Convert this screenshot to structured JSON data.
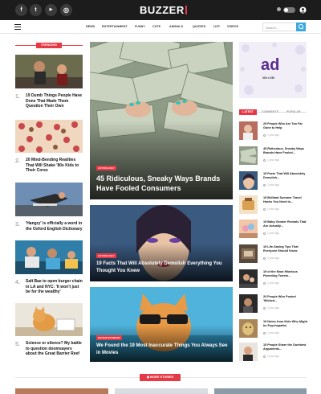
{
  "brand": {
    "logo": "BUZZER"
  },
  "header": {
    "social_icons": [
      "facebook-icon",
      "twitter-icon",
      "youtube-icon",
      "instagram-icon"
    ],
    "social_glyphs": [
      "f",
      "t",
      "▶",
      "◎"
    ]
  },
  "nav": {
    "items": [
      "NEWS",
      "ENTERTAINMENT",
      "FUNNY",
      "CUTE",
      "ANIMALS",
      "QUIZZES",
      "LIST",
      "VIDEOS"
    ],
    "search_placeholder": "Search..."
  },
  "trending": {
    "label": "TRENDING",
    "items": [
      {
        "num": "1.",
        "title": "19 Dumb Things People Have Done That Made Them Question Their Own"
      },
      {
        "num": "2.",
        "title": "20 Mind-Bending Realities That Will Shake '80s Kids to Their Cores"
      },
      {
        "num": "3.",
        "title": "'Hangry' is officially a word in the Oxford English Dictionary"
      },
      {
        "num": "4.",
        "title": "Salt Bae to open burger chain in LA and NYC: 'It won't just be for the wealthy'"
      },
      {
        "num": "5.",
        "title": "Science or silence? My battle to question doomsayers about the Great Barrier Reef"
      }
    ]
  },
  "featured": [
    {
      "category": "ASTROLOGY",
      "title": "45 Ridiculous, Sneaky Ways Brands Have Fooled Consumers"
    },
    {
      "category": "ASTROLOGY",
      "title": "19 Facts That Will Absolutely Demolish Everything You Thought You Knew"
    },
    {
      "category": "ENTERTAINMENT",
      "title": "We Found the 19 Most Inaccurate Things You Always See in Movies"
    }
  ],
  "ad": {
    "text": "ad",
    "size": "300 x 250"
  },
  "sidebar": {
    "tabs": [
      "LATEST",
      "COMMENTS",
      "POPULAR"
    ],
    "items": [
      {
        "title": "25 People Who Are Too Far Gone to Help",
        "meta": "1 year ago"
      },
      {
        "title": "45 Ridiculous, Sneaky Ways Brands Have Fooled...",
        "meta": "1 year ago"
      },
      {
        "title": "19 Facts That Will Absolutely Demolish...",
        "meta": "1 year ago"
      },
      {
        "title": "19 Brilliant Summer Travel Hacks You Need to...",
        "meta": "1 year ago"
      },
      {
        "title": "19 Baby Gender Reveals That Are Actually...",
        "meta": "1 year ago"
      },
      {
        "title": "19 Life-Saving Tips That Everyone Should Know",
        "meta": "1 year ago"
      },
      {
        "title": "19 of the Most Hilarious Parenting Tweets...",
        "meta": "1 year ago"
      },
      {
        "title": "20 People Who Posted 'Wicked...",
        "meta": "1 year ago"
      },
      {
        "title": "19 Notes from Kids Who Might be Psychopaths",
        "meta": "1 year ago"
      },
      {
        "title": "15 People Share the Dumbest Arguments...",
        "meta": "1 year ago"
      }
    ]
  },
  "more_stories": {
    "label": "MORE STORIES"
  },
  "colors": {
    "accent": "#e63946",
    "dark": "#1c1c1c",
    "search": "#3ba9db"
  }
}
